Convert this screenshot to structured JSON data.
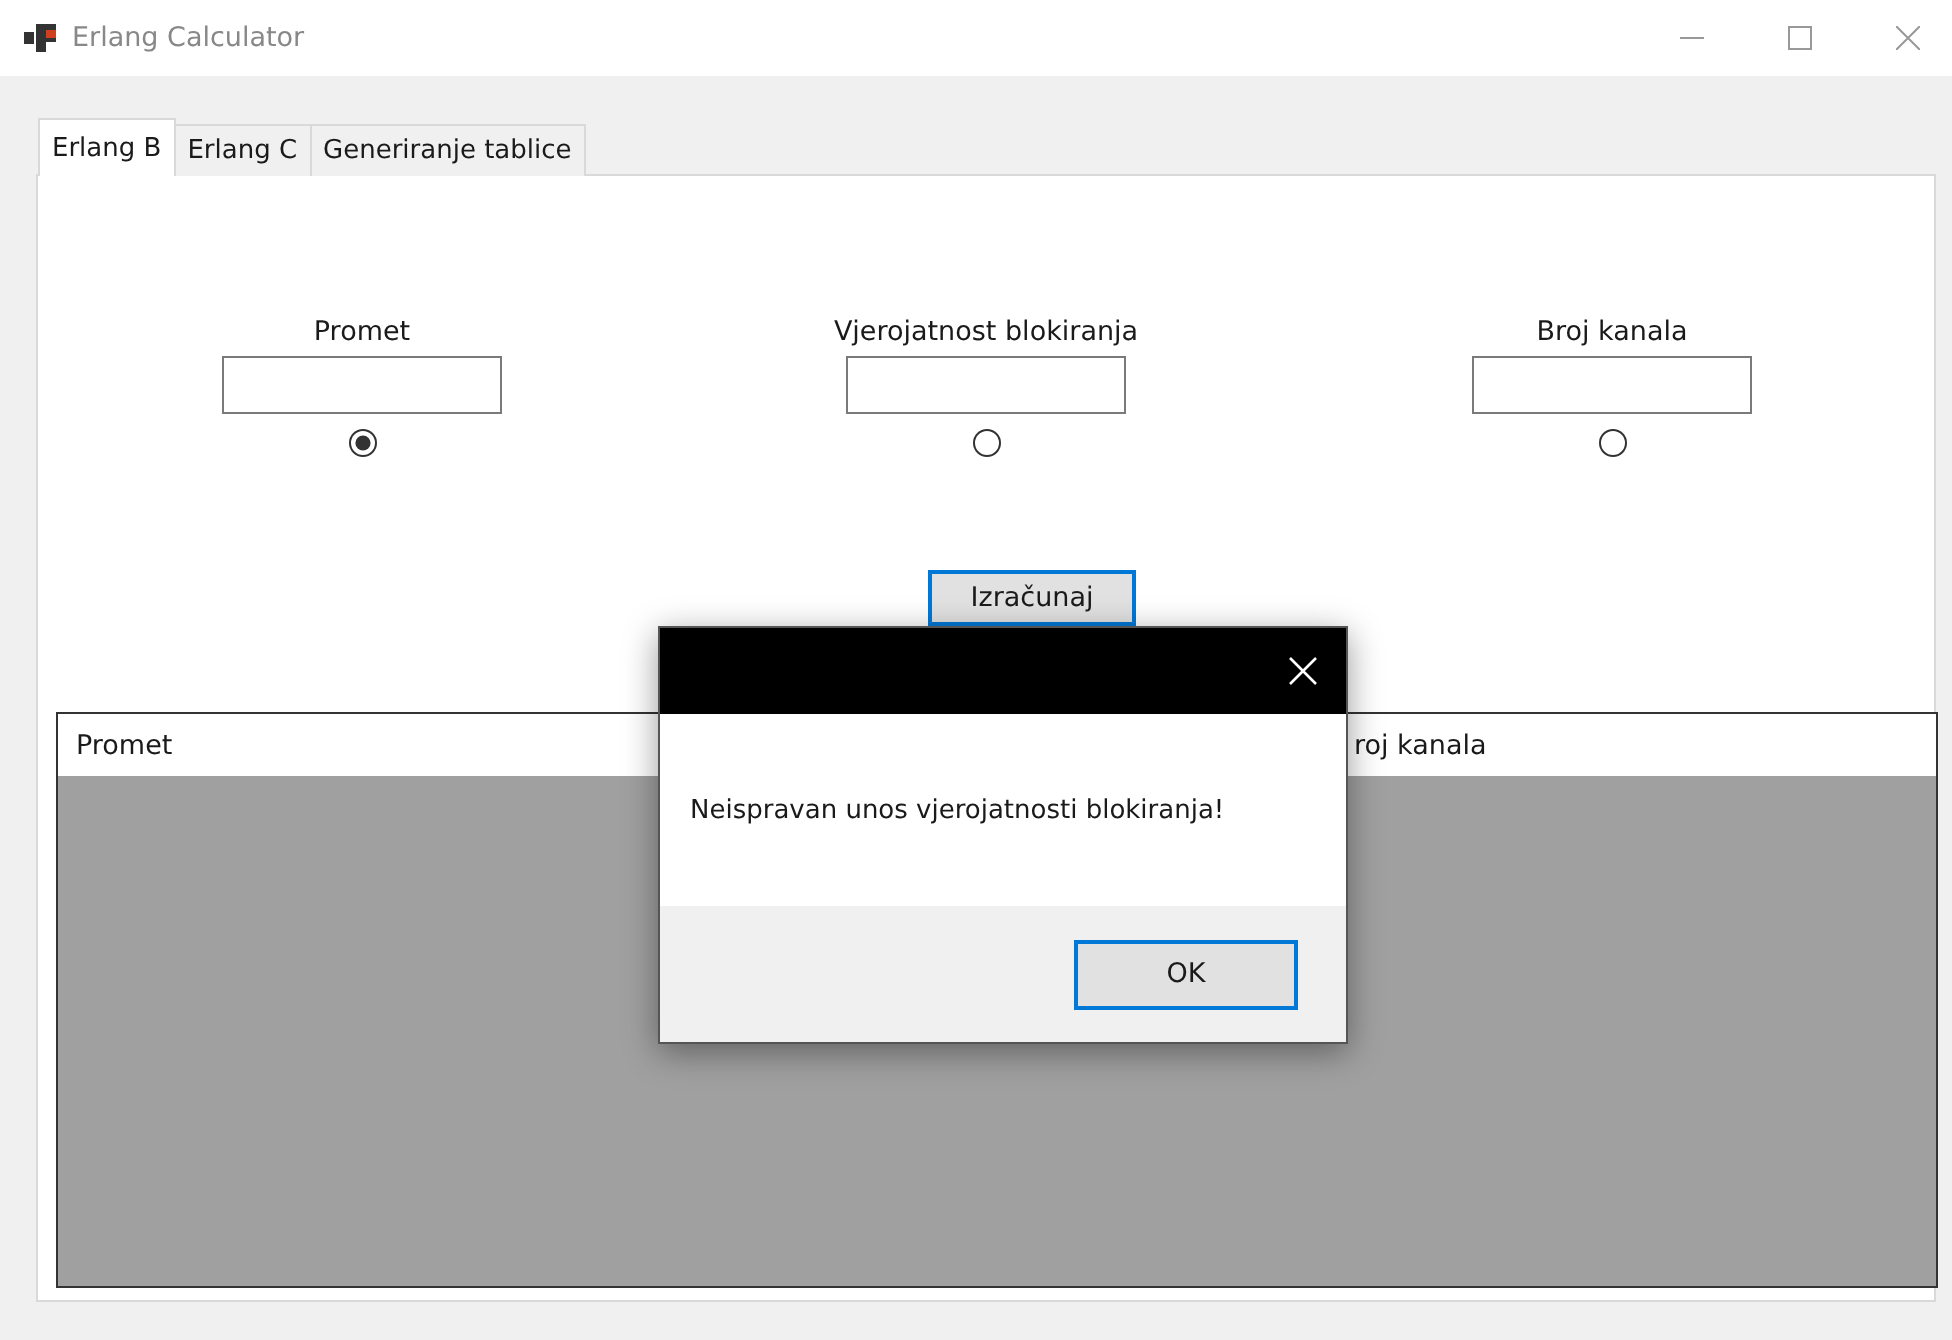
{
  "window": {
    "title": "Erlang Calculator"
  },
  "tabs": [
    {
      "label": "Erlang B",
      "selected": true
    },
    {
      "label": "Erlang C",
      "selected": false
    },
    {
      "label": "Generiranje tablice",
      "selected": false
    }
  ],
  "fields": [
    {
      "label": "Promet",
      "selected": true
    },
    {
      "label": "Vjerojatnost blokiranja",
      "selected": false
    },
    {
      "label": "Broj kanala",
      "selected": false
    }
  ],
  "calculate_button": "Izračunaj",
  "table": {
    "columns": [
      "Promet",
      "roj kanala"
    ]
  },
  "dialog": {
    "message": "Neispravan unos vjerojatnosti blokiranja!",
    "button": "OK"
  }
}
